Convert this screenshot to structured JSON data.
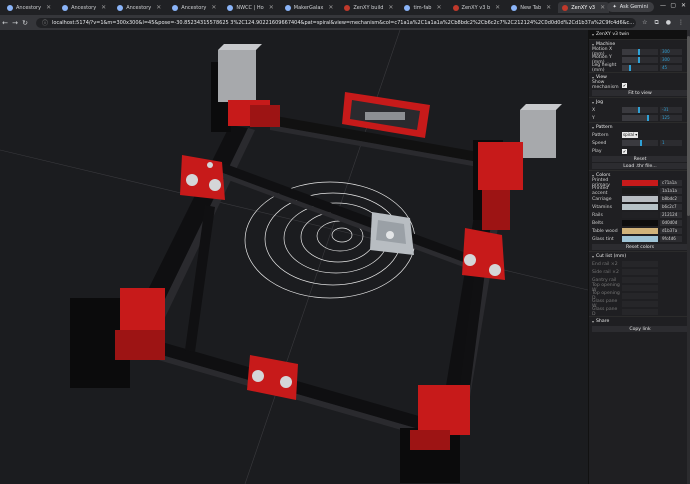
{
  "browser": {
    "tabs": [
      {
        "label": "Ancestory",
        "icon": "globe-icon"
      },
      {
        "label": "Ancestory",
        "icon": "globe-icon"
      },
      {
        "label": "Ancestory",
        "icon": "globe-icon"
      },
      {
        "label": "Ancestory",
        "icon": "globe-icon"
      },
      {
        "label": "NWCC | Ho",
        "icon": "globe-icon"
      },
      {
        "label": "MakerGalax",
        "icon": "globe-icon"
      },
      {
        "label": "ZenXY build",
        "icon": "globe-icon"
      },
      {
        "label": "tim-fab",
        "icon": "globe-icon"
      },
      {
        "label": "ZenXY v3 b",
        "icon": "globe-icon"
      },
      {
        "label": "New Tab",
        "icon": "globe-icon"
      },
      {
        "label": "ZenXY v3",
        "icon": "globe-icon"
      }
    ],
    "ask_gemini": "Ask Gemini",
    "url": "localhost:5174/?v=1&m=300x300&l=45&pose=-30.85234315578625 3%2C124.90221609667404&pat=spiral&view=mechanism&col=c71a1a%2C1a1a1a%2Cb8bdc2%2Cb6c2c7%2C212124%2C0d0d0d%2Cd1b37a%2C9fc4d6&c..."
  },
  "panel": {
    "title": "ZenXY v3 twin",
    "sections": {
      "machine": "Machine",
      "view": "View",
      "jog": "Jog",
      "pattern": "Pattern",
      "colors": "Colors",
      "cut_list": "Cut list (mm)",
      "share": "Share"
    },
    "machine": [
      {
        "label": "Motion X (mm)",
        "value": "300",
        "fraction": 0.45
      },
      {
        "label": "Motion Y (mm)",
        "value": "300",
        "fraction": 0.45
      },
      {
        "label": "Leg height (mm)",
        "value": "45",
        "fraction": 0.2
      }
    ],
    "view": {
      "show_mechanism": "Show mechanism",
      "show_mechanism_checked": "✔",
      "fit_to_view": "Fit to view"
    },
    "jog": [
      {
        "label": "X",
        "value": "-31",
        "fraction": 0.45
      },
      {
        "label": "Y",
        "value": "125",
        "fraction": 0.7
      }
    ],
    "pattern": {
      "pattern_label": "Pattern",
      "pattern_value": "spiral",
      "speed_label": "Speed",
      "speed_value": "1",
      "speed_fraction": 0.5,
      "play_label": "Play",
      "play_checked": "✔",
      "reset": "Reset",
      "load_file": "Load .thr file..."
    },
    "colors": [
      {
        "label": "Printed primary",
        "hex": "c71a1a",
        "color": "#c71a1a"
      },
      {
        "label": "Printed accent",
        "hex": "1a1a1a",
        "color": "#1a1a1a"
      },
      {
        "label": "Carriage",
        "hex": "b8bdc2",
        "color": "#b8bdc2"
      },
      {
        "label": "Vitamins",
        "hex": "b6c2c7",
        "color": "#b6c2c7"
      },
      {
        "label": "Rails",
        "hex": "212124",
        "color": "#212124"
      },
      {
        "label": "Belts",
        "hex": "0d0d0d",
        "color": "#0d0d0d"
      },
      {
        "label": "Table wood",
        "hex": "d1b37a",
        "color": "#d1b37a"
      },
      {
        "label": "Glass tint",
        "hex": "9fc4d6",
        "color": "#9fc4d6"
      }
    ],
    "reset_colors": "Reset colors",
    "cut_list": [
      "End rail ×2",
      "Side rail ×2",
      "Gantry rail",
      "Top opening W",
      "Top opening D",
      "Glass pane W",
      "Glass pane D"
    ],
    "copy_link": "Copy link"
  }
}
